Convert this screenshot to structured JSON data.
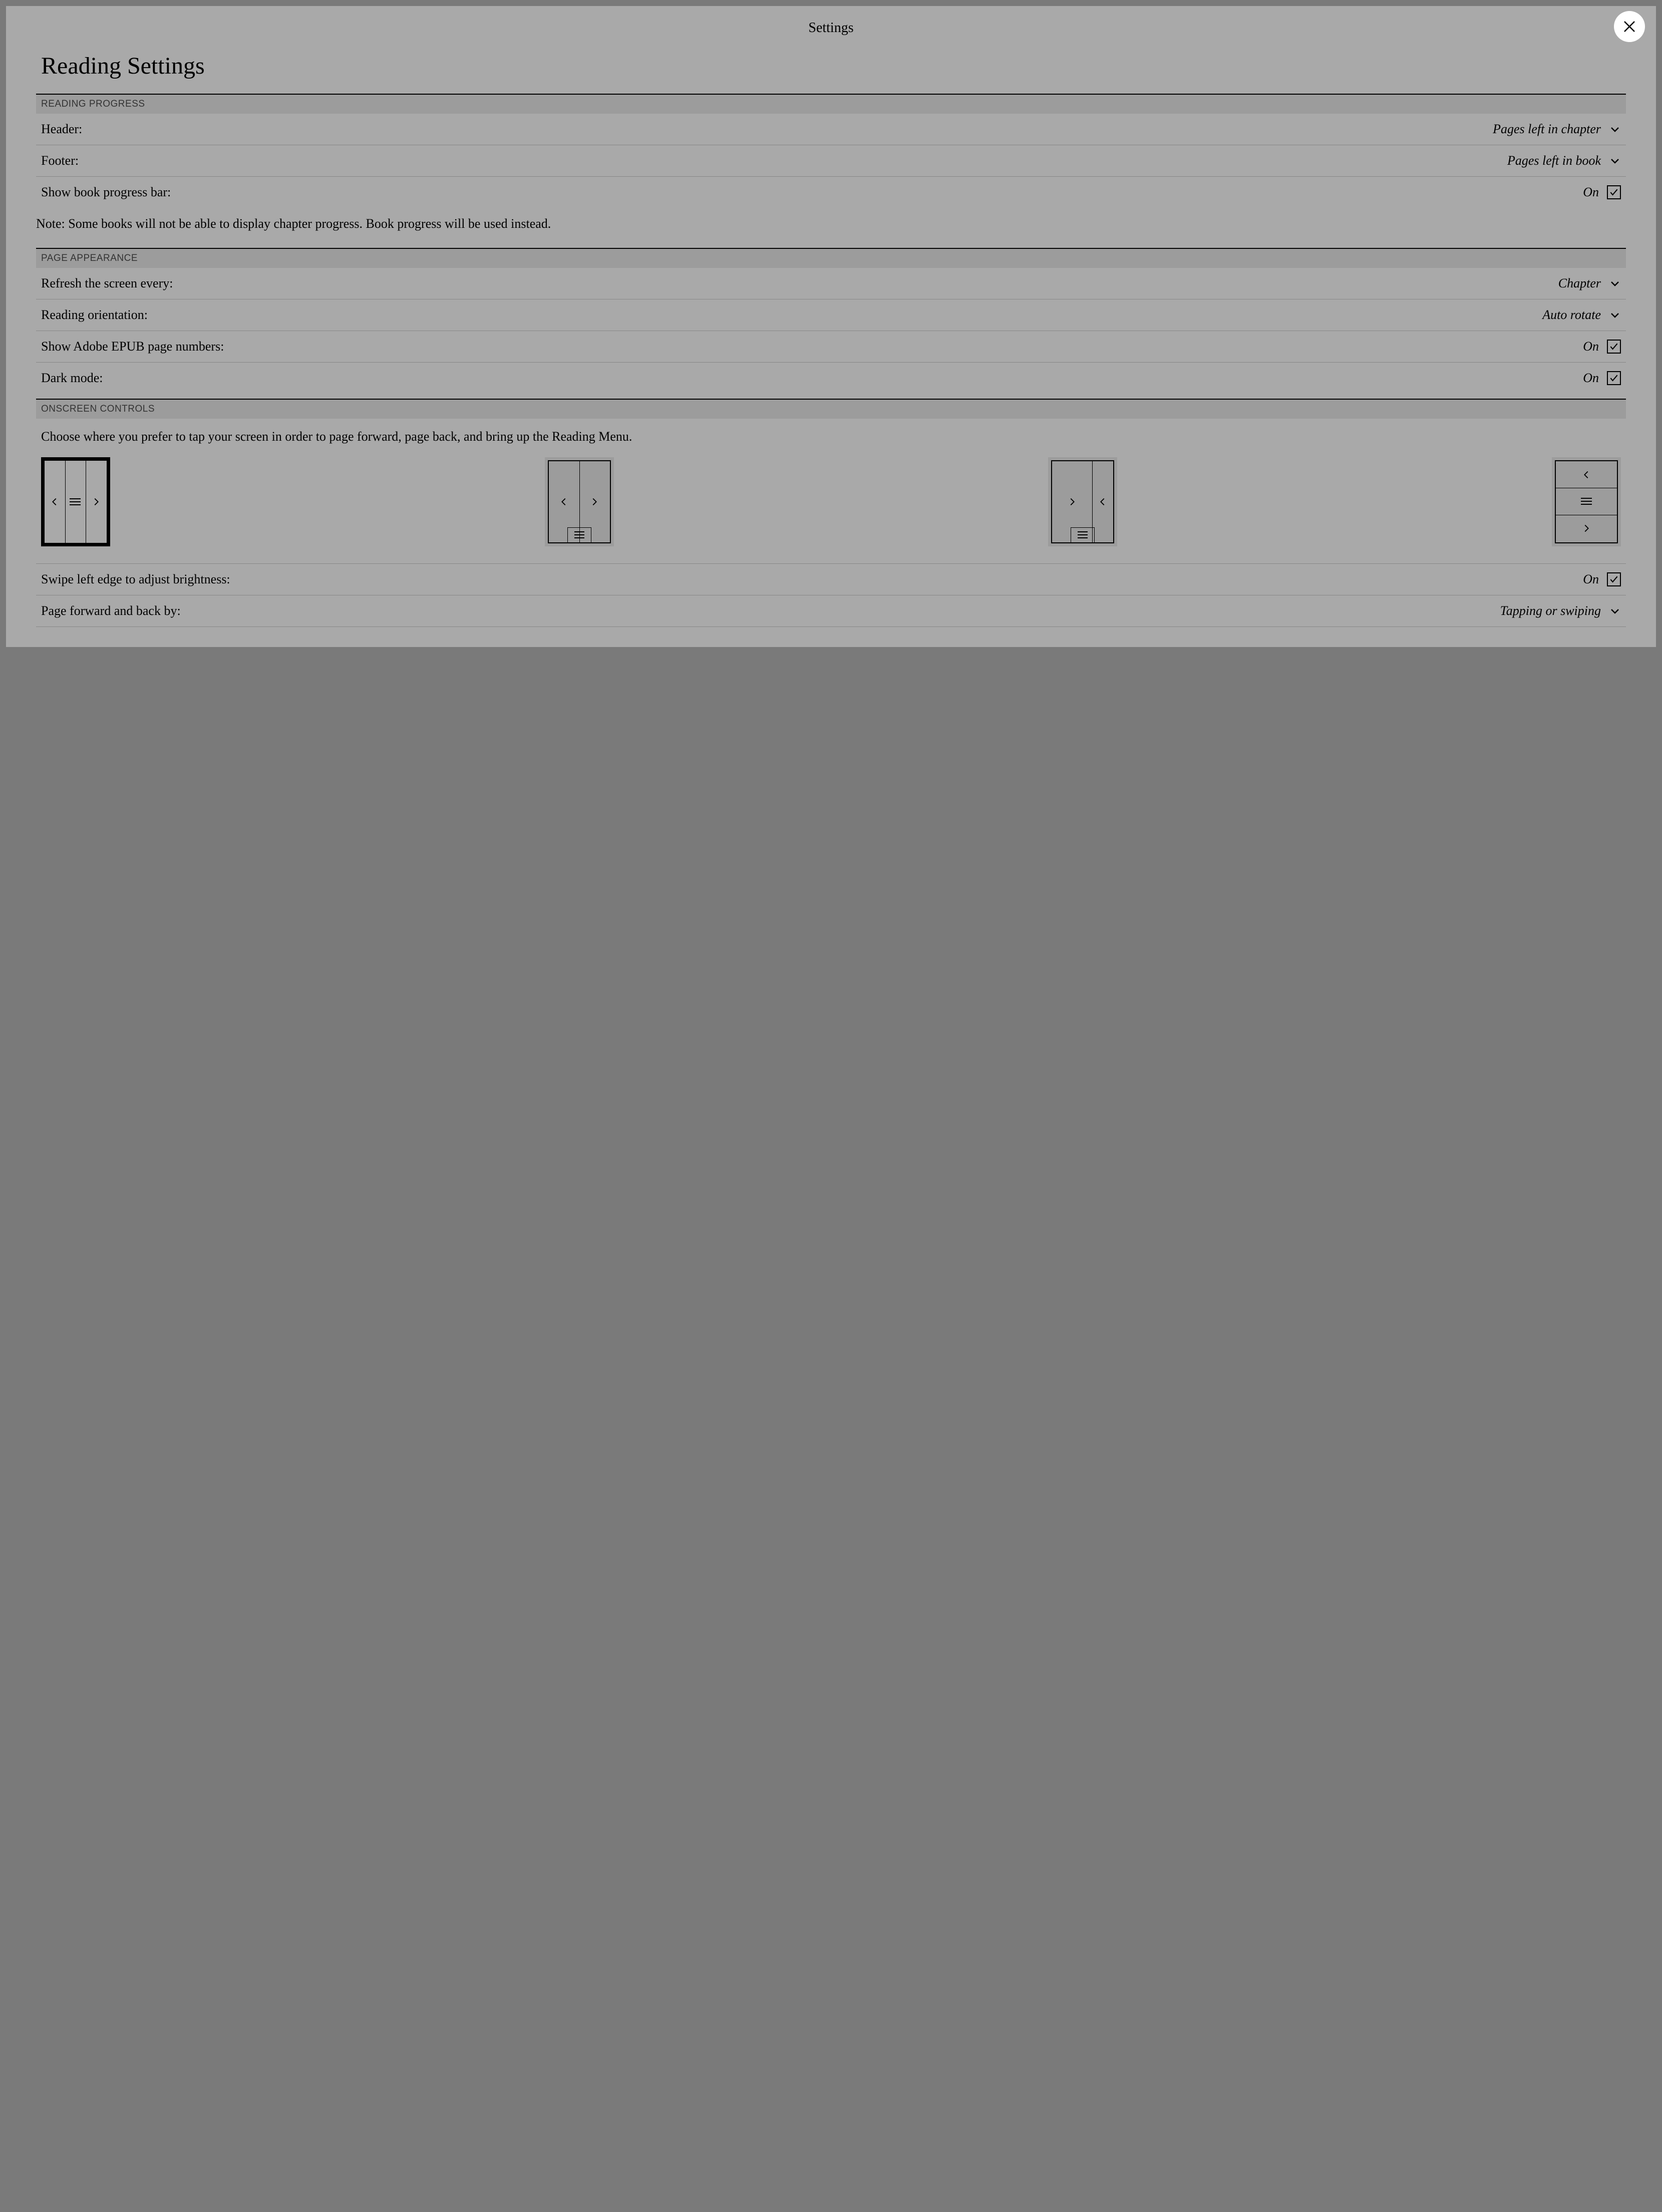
{
  "modal_title": "Settings",
  "page_title": "Reading Settings",
  "sections": {
    "reading_progress": {
      "header": "READING PROGRESS",
      "header_row": {
        "label": "Header:",
        "value": "Pages left in chapter"
      },
      "footer_row": {
        "label": "Footer:",
        "value": "Pages left in book"
      },
      "progress_bar": {
        "label": "Show book progress bar:",
        "value": "On"
      },
      "note": "Note: Some books will not be able to display chapter progress. Book progress will be used instead."
    },
    "page_appearance": {
      "header": "PAGE APPEARANCE",
      "refresh": {
        "label": "Refresh the screen every:",
        "value": "Chapter"
      },
      "orientation": {
        "label": "Reading orientation:",
        "value": "Auto rotate"
      },
      "epub_numbers": {
        "label": "Show Adobe EPUB page numbers:",
        "value": "On"
      },
      "dark_mode": {
        "label": "Dark mode:",
        "value": "On"
      }
    },
    "onscreen_controls": {
      "header": "ONSCREEN CONTROLS",
      "description": "Choose where you prefer to tap your screen in order to page forward, page back, and bring up the Reading Menu.",
      "swipe_brightness": {
        "label": "Swipe left edge to adjust brightness:",
        "value": "On"
      },
      "page_forward_back": {
        "label": "Page forward and back by:",
        "value": "Tapping or swiping"
      },
      "selected_layout": 0
    }
  }
}
